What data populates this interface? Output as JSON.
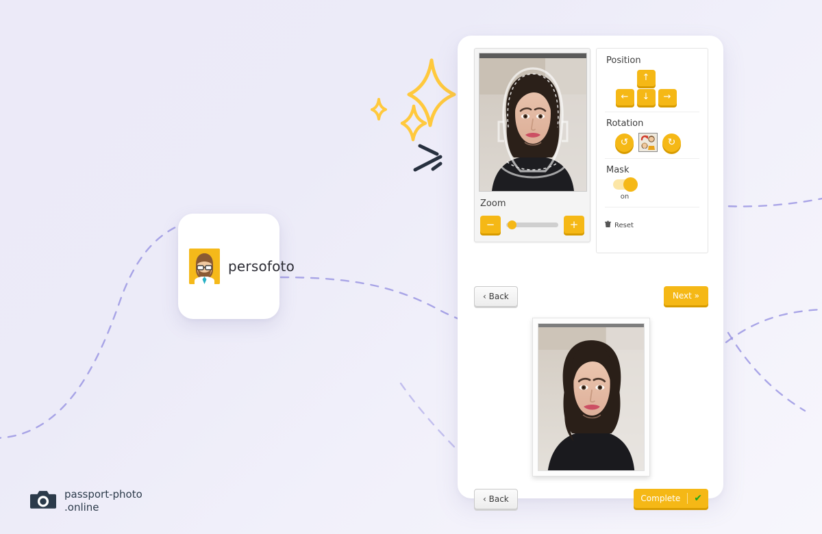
{
  "brand": {
    "logo_card_name": "persofoto",
    "logo_icon": "bearded-man-avatar-icon",
    "watermark_line1": "passport-photo",
    "watermark_line2": ".online",
    "watermark_icon": "camera-icon"
  },
  "colors": {
    "accent": "#f5b816",
    "accent_shadow": "#d79b00",
    "accent_soft": "#fce6a6",
    "page_bg_start": "#eceaf8",
    "page_bg_end": "#f7f6fc",
    "dashed_path": "#9b96e3",
    "sparkle": "#ffc93d",
    "dark_dash": "#27303f",
    "check_green": "#17a61c",
    "text_dark": "#3c3c3c"
  },
  "editor": {
    "photo_alt": "passport photo preview with face mask guide overlay",
    "zoom": {
      "label": "Zoom",
      "minus_label": "−",
      "plus_label": "+",
      "value_percent": 5
    },
    "position": {
      "title": "Position",
      "up_label": "↑",
      "down_label": "↓",
      "left_label": "←",
      "right_label": "→"
    },
    "rotation": {
      "title": "Rotation",
      "ccw_label": "↺",
      "cw_label": "↻",
      "auto_icon": "rotate-face-icon"
    },
    "mask": {
      "title": "Mask",
      "state": "on",
      "enabled": true
    },
    "reset": {
      "label": "Reset",
      "icon": "trash-icon"
    }
  },
  "nav_editor": {
    "back_label": "‹ Back",
    "next_label": "Next »"
  },
  "result": {
    "photo_alt": "final cropped passport photo"
  },
  "nav_result": {
    "back_label": "‹ Back",
    "complete_label": "Complete",
    "complete_icon": "check-icon"
  },
  "decor": {
    "sparkles": [
      "large-sparkle",
      "small-sparkle",
      "medium-sparkle"
    ],
    "dashes": [
      "dash-short",
      "dash-long",
      "dash-tiny"
    ],
    "paths": [
      "dashed-curve-left",
      "dashed-curve-right-top",
      "dashed-curve-right-bottom"
    ]
  }
}
